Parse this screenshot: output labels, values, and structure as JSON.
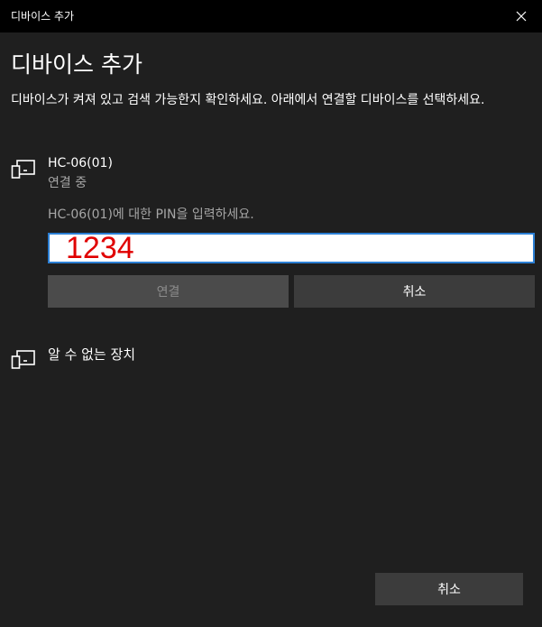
{
  "window": {
    "title": "디바이스 추가",
    "close_icon": "close-icon"
  },
  "heading": "디바이스 추가",
  "instructions": "디바이스가 켜져 있고 검색 가능한지 확인하세요. 아래에서 연결할 디바이스를 선택하세요.",
  "devices": [
    {
      "icon": "device-icon",
      "name": "HC-06(01)",
      "status": "연결 중",
      "pin_prompt": "HC-06(01)에 대한 PIN을 입력하세요.",
      "pin_value": "1234",
      "connect_label": "연결",
      "cancel_label": "취소"
    },
    {
      "icon": "device-icon",
      "name": "알 수 없는 장치"
    }
  ],
  "footer": {
    "cancel_label": "취소"
  },
  "colors": {
    "background": "#1f1f1f",
    "titlebar": "#000000",
    "input_border_accent": "#2b7fd4",
    "pin_text": "#e00000",
    "disabled_button": "#4b4b4b",
    "button": "#3c3c3c",
    "secondary_text": "#a6a6a6"
  }
}
